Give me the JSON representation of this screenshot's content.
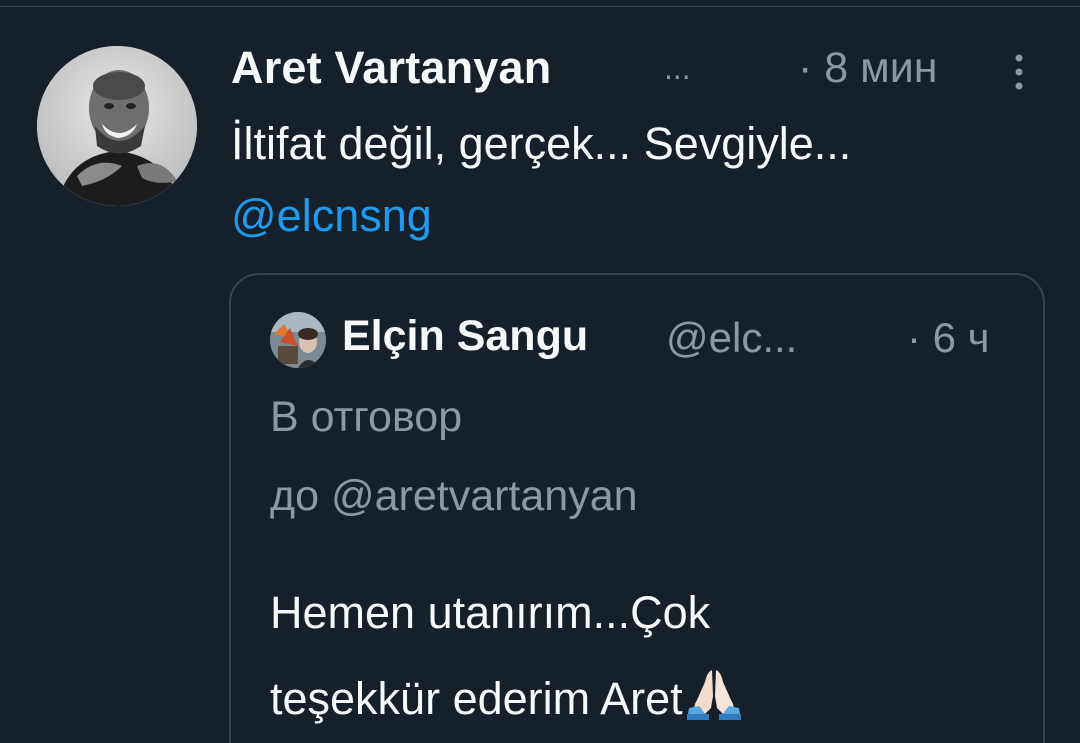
{
  "tweet": {
    "author_name": "Aret Vartanyan",
    "author_ellipsis": "...",
    "time": "· 8 мин",
    "text": "İltifat değil, gerçek... Sevgiyle...",
    "mention": "@elcnsng",
    "more_icon": "more-vertical-icon"
  },
  "quote": {
    "author_name": "Elçin Sangu",
    "handle": "@elc...",
    "time": "· 6 ч",
    "reply_line1": "В отговор",
    "reply_line2": "до @aretvartanyan",
    "text_line1": "Hemen utanırım...Çok",
    "text_line2": "teşekkür ederim Aret",
    "emoji": "folded-hands-icon"
  },
  "colors": {
    "background": "#15202b",
    "text": "#f7f9f9",
    "secondary": "#8b98a5",
    "link": "#1d9bf0",
    "border": "#38444d"
  }
}
